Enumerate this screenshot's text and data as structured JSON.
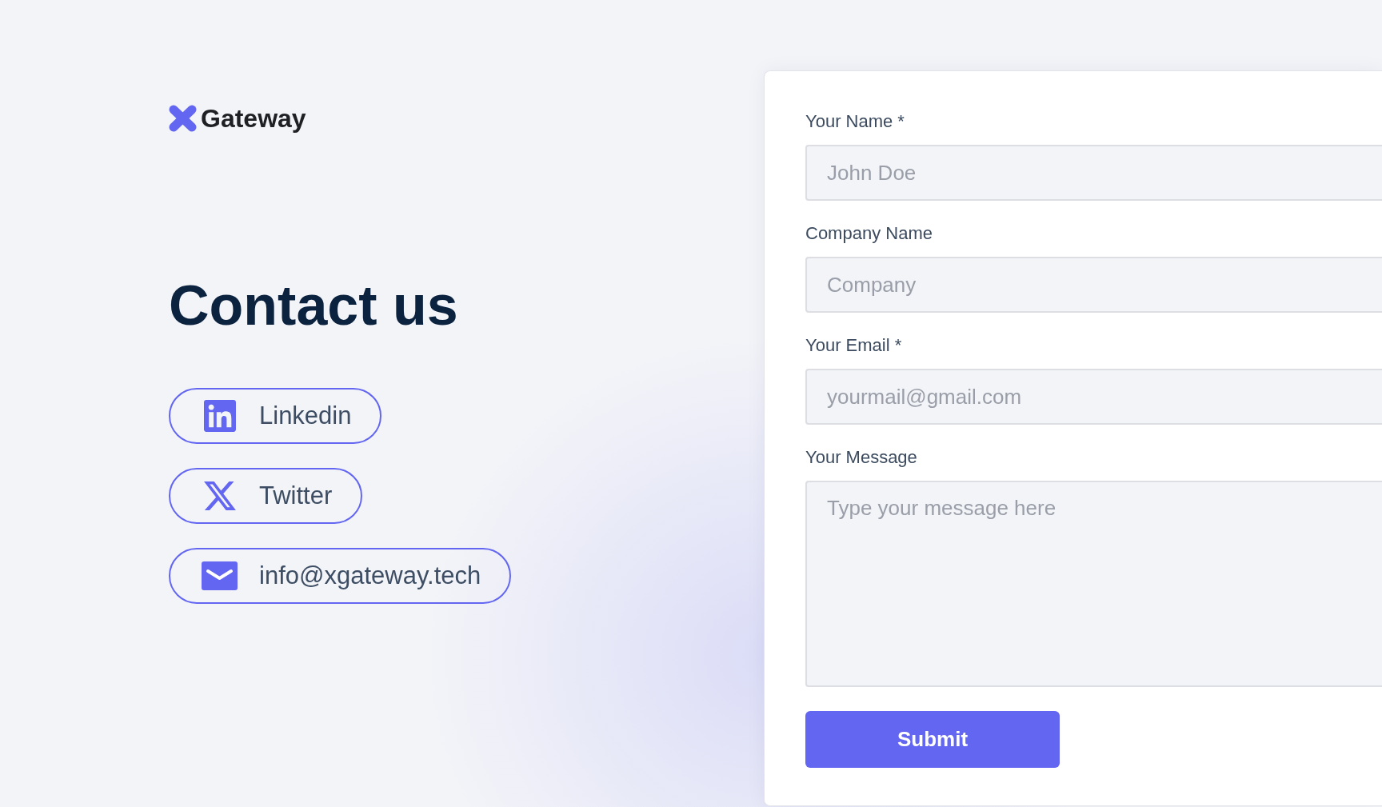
{
  "logo": {
    "text": "Gateway"
  },
  "heading": "Contact us",
  "contacts": [
    {
      "kind": "linkedin",
      "label": "Linkedin"
    },
    {
      "kind": "twitter",
      "label": "Twitter"
    },
    {
      "kind": "email",
      "label": "info@xgateway.tech"
    }
  ],
  "form": {
    "fields": [
      {
        "kind": "input",
        "label": "Your Name *",
        "placeholder": "John Doe"
      },
      {
        "kind": "input",
        "label": "Company Name",
        "placeholder": "Company"
      },
      {
        "kind": "input",
        "label": "Your Email *",
        "placeholder": "yourmail@gmail.com"
      },
      {
        "kind": "textarea",
        "label": "Your Message",
        "placeholder": "Type your message here"
      }
    ],
    "submit": "Submit"
  }
}
